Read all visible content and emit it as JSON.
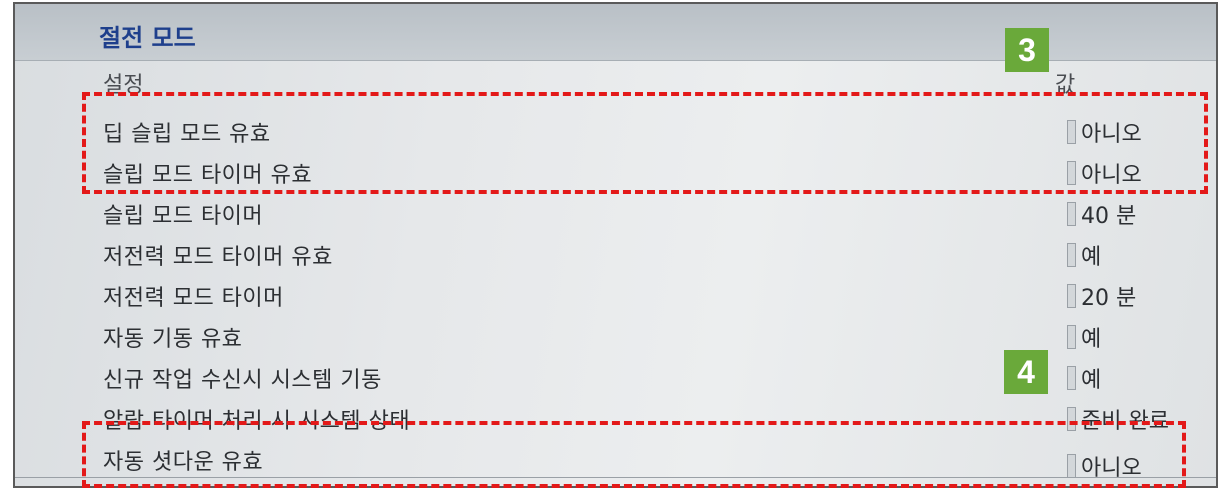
{
  "window": {
    "title": "절전 모드"
  },
  "columns": {
    "setting": "설정",
    "value": "값"
  },
  "rows": [
    {
      "label": "딥 슬립 모드 유효",
      "value": "아니오"
    },
    {
      "label": "슬립 모드 타이머 유효",
      "value": "아니오"
    },
    {
      "label": "슬립 모드 타이머",
      "value": "40 분"
    },
    {
      "label": "저전력 모드 타이머 유효",
      "value": "예"
    },
    {
      "label": "저전력 모드 타이머",
      "value": "20 분"
    },
    {
      "label": "자동 기동 유효",
      "value": "예"
    },
    {
      "label": "신규 작업 수신시 시스템 기동",
      "value": "예"
    },
    {
      "label": "알람 타이머 처리 시 시스템 상태",
      "value": "준비 완료"
    },
    {
      "label": "자동 셧다운 유효",
      "value": "아니오"
    }
  ],
  "annotations": [
    {
      "badge": "3",
      "color": "#6aa93a"
    },
    {
      "badge": "4",
      "color": "#6aa93a"
    }
  ],
  "colors": {
    "callout_border": "#e31919",
    "badge_bg": "#6aa93a",
    "title_text": "#1e3f8c"
  }
}
